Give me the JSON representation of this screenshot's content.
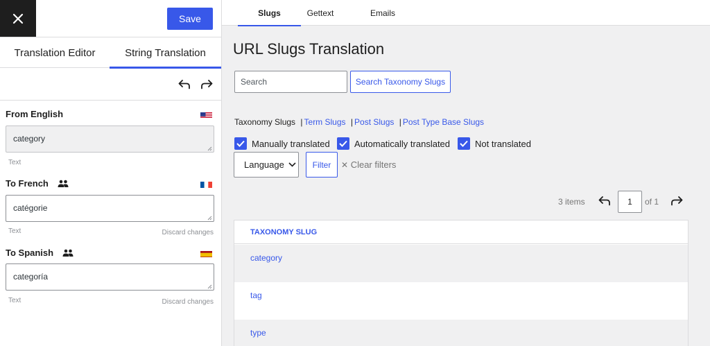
{
  "editor": {
    "save_label": "Save",
    "tabs": [
      {
        "label": "Translation Editor",
        "active": false
      },
      {
        "label": "String Translation",
        "active": true
      }
    ],
    "icons": {
      "close": "close-icon",
      "undo": "undo-icon",
      "redo": "redo-icon",
      "users": "people-icon"
    },
    "source": {
      "label": "From English",
      "flag": "us-flag",
      "value": "category",
      "type": "Text"
    },
    "targets": [
      {
        "label": "To French",
        "flag": "fr-flag",
        "value": "catégorie",
        "type": "Text",
        "discard": "Discard changes"
      },
      {
        "label": "To Spanish",
        "flag": "es-flag",
        "value": "categoría",
        "type": "Text",
        "discard": "Discard changes"
      }
    ]
  },
  "main": {
    "tabs": [
      {
        "label": "Slugs",
        "active": true
      },
      {
        "label": "Gettext",
        "active": false
      },
      {
        "label": "Emails",
        "active": false
      }
    ],
    "title": "URL Slugs Translation",
    "search": {
      "placeholder": "Search",
      "button": "Search Taxonomy Slugs"
    },
    "subnav": {
      "current": "Taxonomy Slugs",
      "links": [
        "Term Slugs",
        "Post Slugs",
        "Post Type Base Slugs"
      ],
      "separator": "|"
    },
    "filters": {
      "checkboxes": [
        {
          "label": "Manually translated",
          "checked": true
        },
        {
          "label": "Automatically translated",
          "checked": true
        },
        {
          "label": "Not translated",
          "checked": true
        }
      ],
      "language_select": "Language",
      "filter_button": "Filter",
      "clear": "Clear filters"
    },
    "pagination": {
      "items": "3 items",
      "page": "1",
      "of": "of 1"
    },
    "table": {
      "header": "TAXONOMY SLUG",
      "rows": [
        "category",
        "tag",
        "type"
      ]
    },
    "colors": {
      "accent": "#3858e9",
      "background": "#f0f0f1",
      "dark": "#1e1e1e"
    }
  }
}
